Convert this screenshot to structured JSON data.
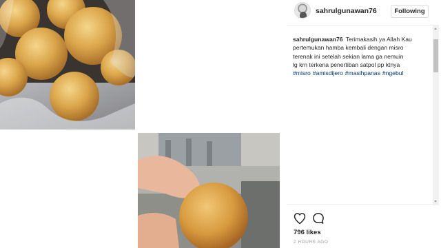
{
  "post": {
    "username": "sahrulgunawan76",
    "follow_label": "Following",
    "caption": {
      "user": "sahrulgunawan76",
      "line1": "Terimakasih ya Allah Kau",
      "line2": "pertemukan hamba kembali dengan misro",
      "line3": "terenak ini setelah sekian lama ga nemuin",
      "line4": "lg krn terkena penertiban satpol pp ktnya",
      "hashtags": [
        "#misro",
        "#amisdijero",
        "#masihpanas",
        "#ngebul"
      ]
    },
    "likes": "796 likes",
    "time": "2 HOURS AGO"
  },
  "icons": {
    "like": "heart-outline-icon",
    "comment": "speech-bubble-icon",
    "avatar": "user-avatar"
  },
  "colors": {
    "hashtag": "#003569",
    "text": "#262626",
    "muted": "#999999",
    "border": "#dbdbdb"
  }
}
